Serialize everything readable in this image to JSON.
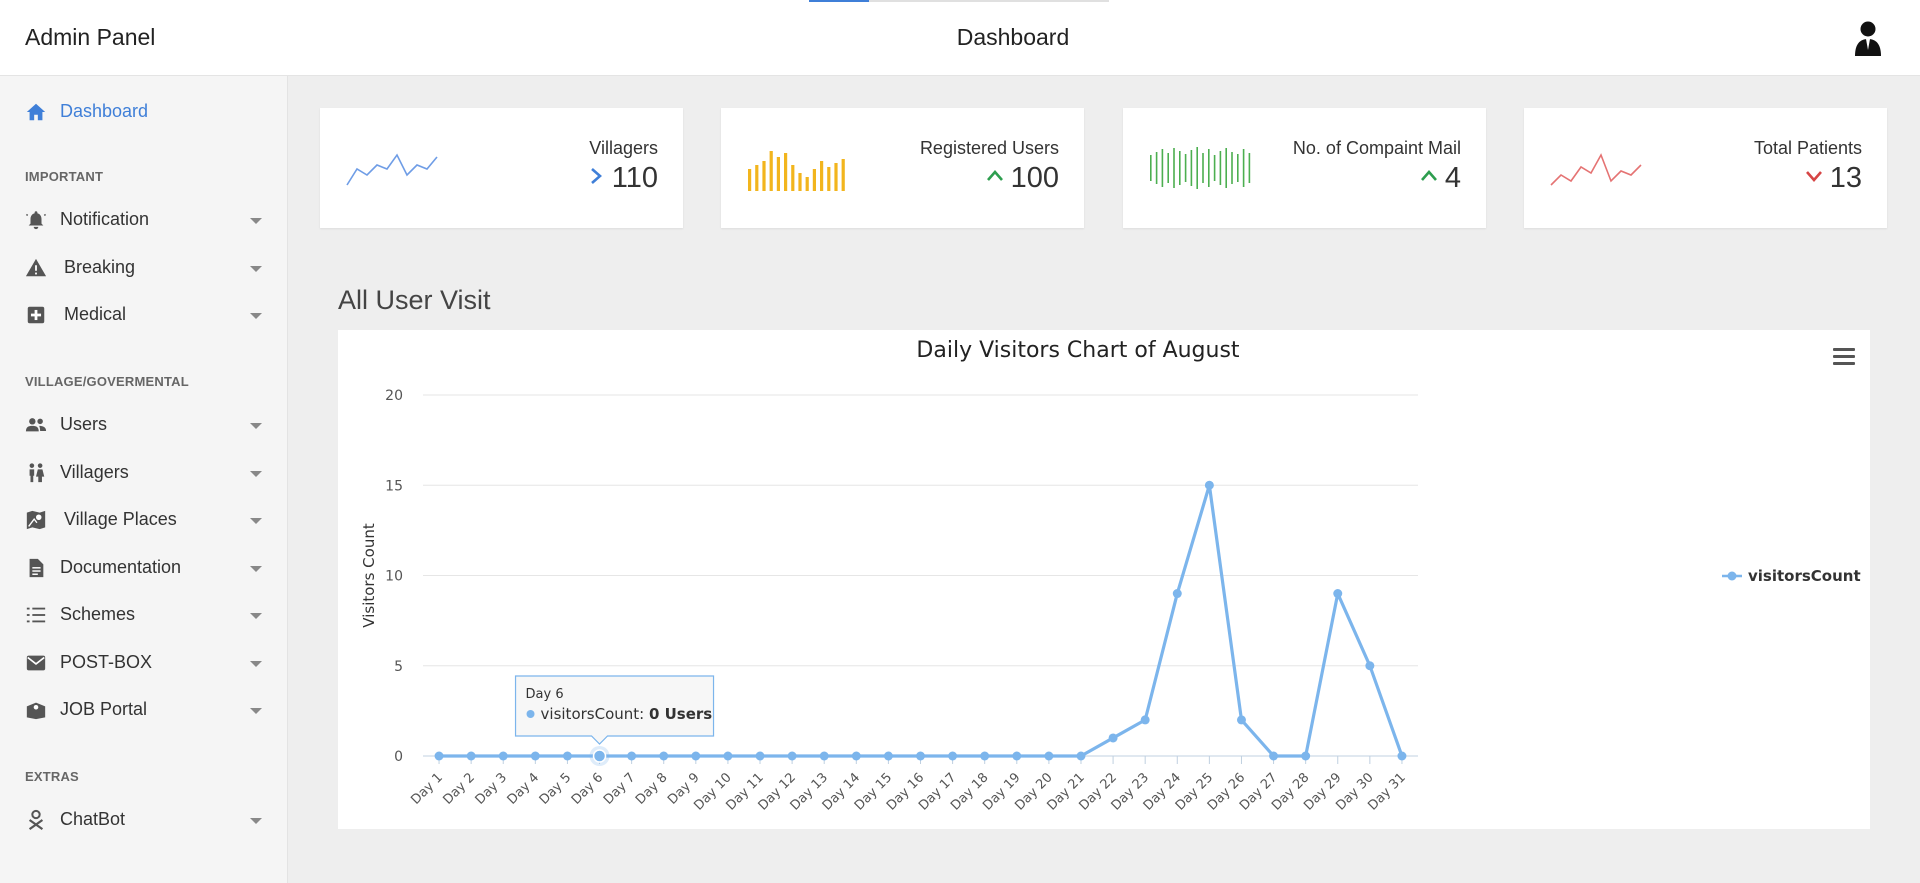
{
  "header": {
    "brand": "Admin Panel",
    "title": "Dashboard",
    "avatar_icon": "user-avatar-icon"
  },
  "sidebar": {
    "dashboard": "Dashboard",
    "sections": [
      "IMPORTANT",
      "VILLAGE/GOVERMENTAL",
      "EXTRAS"
    ],
    "important": [
      {
        "label": "Notification",
        "icon": "bell-icon"
      },
      {
        "label": "Breaking",
        "icon": "warning-icon"
      },
      {
        "label": "Medical",
        "icon": "medical-plus-icon"
      }
    ],
    "village": [
      {
        "label": "Users",
        "icon": "users-icon"
      },
      {
        "label": "Villagers",
        "icon": "villagers-icon"
      },
      {
        "label": "Village Places",
        "icon": "map-pin-icon"
      },
      {
        "label": "Documentation",
        "icon": "document-icon"
      },
      {
        "label": "Schemes",
        "icon": "list-icon"
      },
      {
        "label": "POST-BOX",
        "icon": "mail-icon"
      },
      {
        "label": "JOB Portal",
        "icon": "job-icon"
      }
    ],
    "extras": [
      {
        "label": "ChatBot",
        "icon": "chatbot-icon"
      }
    ]
  },
  "cards": [
    {
      "name": "Villagers",
      "value": "110",
      "trend": "neutral",
      "color": "#3f7fd8",
      "spark_type": "line",
      "spark_color": "#6f9de6"
    },
    {
      "name": "Registered Users",
      "value": "100",
      "trend": "up",
      "color": "#2e9e4f",
      "spark_type": "bar",
      "spark_color": "#f2b51d"
    },
    {
      "name": "No. of Compaint Mail",
      "value": "4",
      "trend": "up",
      "color": "#2e9e4f",
      "spark_type": "bar",
      "spark_color": "#4caf50"
    },
    {
      "name": "Total Patients",
      "value": "13",
      "trend": "down",
      "color": "#d64545",
      "spark_type": "line",
      "spark_color": "#e57373"
    }
  ],
  "section_title": "All User Visit",
  "chart_data": {
    "type": "line",
    "title": "Daily Visitors Chart of August",
    "xlabel": "",
    "ylabel": "Visitors Count",
    "ylim": [
      0,
      20
    ],
    "yticks": [
      0,
      5,
      10,
      15,
      20
    ],
    "categories": [
      "Day 1",
      "Day 2",
      "Day 3",
      "Day 4",
      "Day 5",
      "Day 6",
      "Day 7",
      "Day 8",
      "Day 9",
      "Day 10",
      "Day 11",
      "Day 12",
      "Day 13",
      "Day 14",
      "Day 15",
      "Day 16",
      "Day 17",
      "Day 18",
      "Day 19",
      "Day 20",
      "Day 21",
      "Day 22",
      "Day 23",
      "Day 24",
      "Day 25",
      "Day 26",
      "Day 27",
      "Day 28",
      "Day 29",
      "Day 30",
      "Day 31"
    ],
    "series": [
      {
        "name": "visitorsCount",
        "color": "#7cb5ec",
        "values": [
          0,
          0,
          0,
          0,
          0,
          0,
          0,
          0,
          0,
          0,
          0,
          0,
          0,
          0,
          0,
          0,
          0,
          0,
          0,
          0,
          0,
          1,
          2,
          9,
          15,
          2,
          0,
          0,
          9,
          5,
          0
        ]
      }
    ],
    "grid": true,
    "legend": "right",
    "tooltip": {
      "category": "Day 6",
      "series": "visitorsCount",
      "value_text": "0 Users"
    }
  }
}
